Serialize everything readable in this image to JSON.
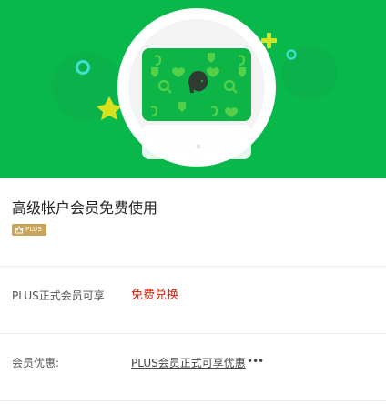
{
  "hero": {
    "icons": [
      "evernote-elephant-icon",
      "heart-icon",
      "search-icon",
      "shield-icon",
      "spiral-icon",
      "star-icon",
      "plus-icon",
      "ring-icon"
    ],
    "colors": {
      "background": "#08b84b",
      "card": "#0db446",
      "accent_yellow": "#d7e21f",
      "accent_cyan": "#3de3d0"
    }
  },
  "membership": {
    "title": "高级帐户会员免费使用",
    "badge": "PLUS"
  },
  "plus_row": {
    "label": "PLUS正式会员可享",
    "action": "免费兑换",
    "action_color": "#d81e06"
  },
  "benefit_row": {
    "label": "会员优惠:",
    "link": "PLUS会员正式可享优惠",
    "more": "•••"
  }
}
